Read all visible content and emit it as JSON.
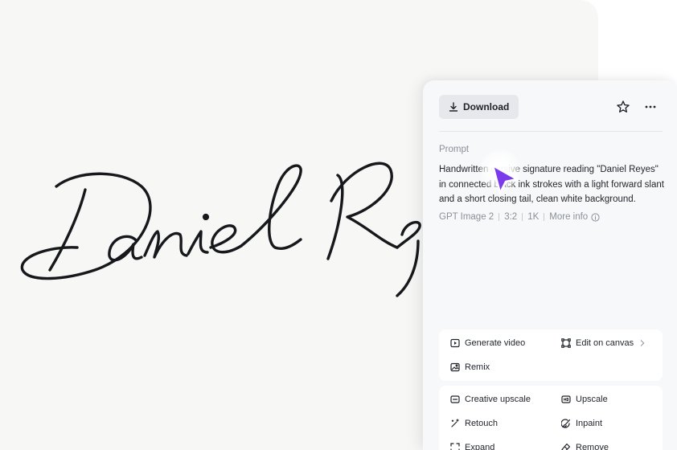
{
  "canvas": {
    "signature_text": "Daniel Reyes",
    "background_color": "#f7f7f6"
  },
  "panel": {
    "download_label": "Download",
    "prompt_heading": "Prompt",
    "prompt_text": "Handwritten cursive signature reading \"Daniel Reyes\" in connected black ink strokes with a light forward slant and a short closing tail, clean white background.",
    "meta": {
      "model": "GPT Image 2",
      "ratio": "3:2",
      "resolution": "1K",
      "more_info_label": "More info"
    },
    "actions_primary": {
      "generate_video": "Generate video",
      "edit_on_canvas": "Edit on canvas",
      "remix": "Remix"
    },
    "actions_secondary": {
      "creative_upscale": "Creative upscale",
      "upscale": "Upscale",
      "retouch": "Retouch",
      "inpaint": "Inpaint",
      "expand": "Expand",
      "remove": "Remove"
    }
  },
  "icons": [
    "download-icon",
    "star-icon",
    "more-icon",
    "info-icon",
    "play-icon",
    "crop-icon",
    "chevron-right-icon",
    "image-icon",
    "upscale-icon",
    "hd-icon",
    "wand-icon",
    "brush-icon",
    "expand-icon",
    "eraser-icon",
    "cursor-icon"
  ],
  "colors": {
    "accent_cursor": "#7c3aed",
    "panel_bg": "#f7f8fa",
    "text": "#1f2329",
    "muted": "#8a8f99"
  }
}
